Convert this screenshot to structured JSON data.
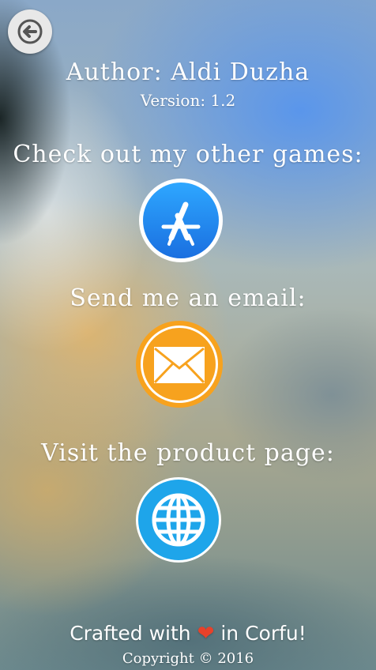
{
  "header": {
    "author": "Author: Aldi Duzha",
    "version": "Version: 1.2"
  },
  "sections": {
    "games_label": "Check out my other games:",
    "email_label": "Send me an email:",
    "product_label": "Visit the product page:"
  },
  "footer": {
    "crafted_prefix": "Crafted with",
    "crafted_suffix": "in Corfu!",
    "copyright": "Copyright © 2016"
  },
  "icons": {
    "back": "back-arrow-icon",
    "app_store": "app-store-icon",
    "email": "envelope-icon",
    "web": "globe-icon",
    "heart": "heart-icon"
  },
  "colors": {
    "app_store_blue": "#1a8cf0",
    "mail_orange": "#f7a21e",
    "globe_blue": "#1ea5ea",
    "heart_red": "#e8412a"
  }
}
